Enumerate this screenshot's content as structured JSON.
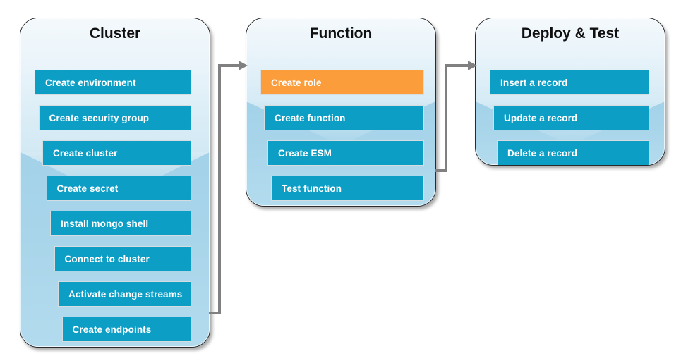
{
  "diagram": {
    "title": "Cluster / Function / Deploy & Test workflow",
    "colors": {
      "step_blue": "#0d9ec6",
      "step_highlight_orange": "#fc9d3c",
      "panel_top": "#f4f9fc",
      "panel_bottom": "#a3d2e9",
      "connector_gray": "#808080",
      "step_text": "#ffffff",
      "panel_title_text": "#101010"
    }
  },
  "panels": [
    {
      "id": "cluster",
      "title": "Cluster",
      "steps": [
        {
          "label": "Create environment",
          "state": "normal"
        },
        {
          "label": "Create security group",
          "state": "normal"
        },
        {
          "label": "Create cluster",
          "state": "normal"
        },
        {
          "label": "Create secret",
          "state": "normal"
        },
        {
          "label": "Install mongo shell",
          "state": "normal"
        },
        {
          "label": "Connect to cluster",
          "state": "normal"
        },
        {
          "label": "Activate change streams",
          "state": "normal"
        },
        {
          "label": "Create endpoints",
          "state": "normal"
        }
      ]
    },
    {
      "id": "function",
      "title": "Function",
      "steps": [
        {
          "label": "Create role",
          "state": "highlight"
        },
        {
          "label": "Create function",
          "state": "normal"
        },
        {
          "label": "Create ESM",
          "state": "normal"
        },
        {
          "label": "Test function",
          "state": "normal"
        }
      ]
    },
    {
      "id": "deploy-test",
      "title": "Deploy & Test",
      "steps": [
        {
          "label": "Insert a record",
          "state": "normal"
        },
        {
          "label": "Update a record",
          "state": "normal"
        },
        {
          "label": "Delete a record",
          "state": "normal"
        }
      ]
    }
  ],
  "connectors": [
    {
      "id": "cluster-to-function",
      "from": "cluster",
      "to": "function",
      "shape": "elbow-up-right"
    },
    {
      "id": "function-to-deploy-test",
      "from": "function",
      "to": "deploy-test",
      "shape": "elbow-up-right"
    }
  ]
}
